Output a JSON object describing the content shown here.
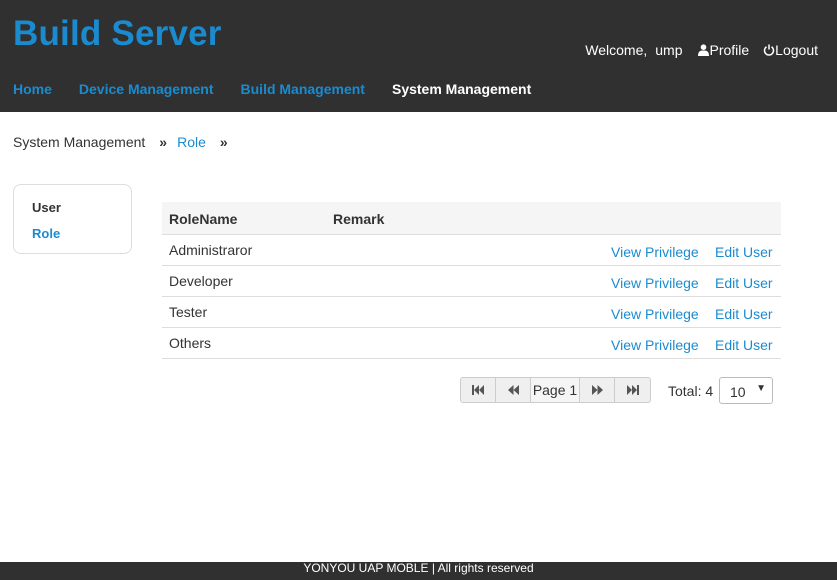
{
  "header": {
    "brand": "Build Server",
    "welcome": "Welcome,",
    "username": "ump",
    "profile_label": "Profile",
    "logout_label": "Logout"
  },
  "nav": {
    "items": [
      {
        "label": "Home",
        "active": false
      },
      {
        "label": "Device Management",
        "active": false
      },
      {
        "label": "Build Management",
        "active": false
      },
      {
        "label": "System Management",
        "active": true
      }
    ]
  },
  "breadcrumb": {
    "root": "System Management",
    "sep": "»",
    "current": "Role"
  },
  "sidebar": {
    "items": [
      {
        "label": "User"
      },
      {
        "label": "Role"
      }
    ]
  },
  "table": {
    "headers": [
      "RoleName",
      "Remark"
    ],
    "rows": [
      {
        "name": "Administraror",
        "remark": "",
        "view": "View Privilege",
        "edit": "Edit User"
      },
      {
        "name": "Developer",
        "remark": "",
        "view": "View Privilege",
        "edit": "Edit User"
      },
      {
        "name": "Tester",
        "remark": "",
        "view": "View Privilege",
        "edit": "Edit User"
      },
      {
        "name": "Others",
        "remark": "",
        "view": "View Privilege",
        "edit": "Edit User"
      }
    ]
  },
  "pagination": {
    "page_label": "Page 1",
    "total_label": "Total: 4",
    "page_size": "10"
  },
  "footer": {
    "text": "YONYOU UAP MOBLE | All rights reserved"
  },
  "colors": {
    "accent": "#1b8bd0",
    "header_bg": "#303030"
  }
}
